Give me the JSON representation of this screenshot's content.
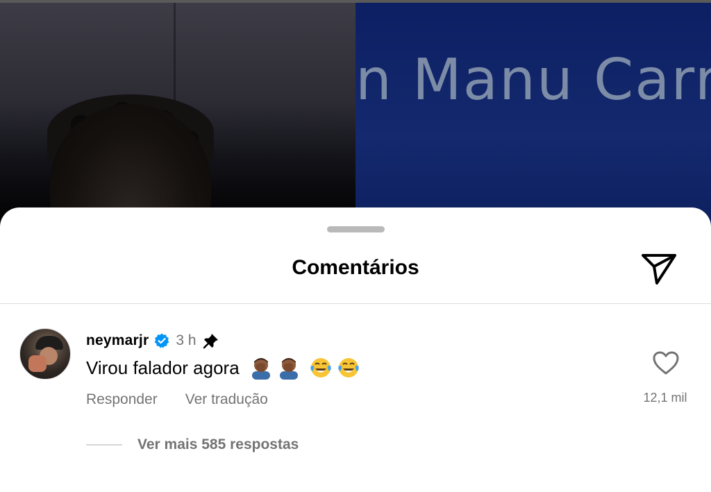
{
  "backdrop": {
    "banner_text": "n Manu Carre"
  },
  "sheet": {
    "title": "Comentários"
  },
  "comment": {
    "username": "neymarjr",
    "time": "3 h",
    "text": "Virou falador agora",
    "emojis": [
      "man-facepalming-medium-dark",
      "man-facepalming-medium-dark",
      "face-with-tears-of-joy",
      "face-with-tears-of-joy"
    ],
    "reply_label": "Responder",
    "translate_label": "Ver tradução",
    "like_count": "12,1 mil",
    "replies_label": "Ver mais 585 respostas"
  },
  "icons": {
    "share": "paper-plane-icon",
    "verified": "verified-badge-icon",
    "pin": "pin-icon",
    "like": "heart-outline-icon"
  },
  "colors": {
    "verified_blue": "#0095f6",
    "secondary_text": "#737373",
    "divider": "#dbdbdb"
  }
}
